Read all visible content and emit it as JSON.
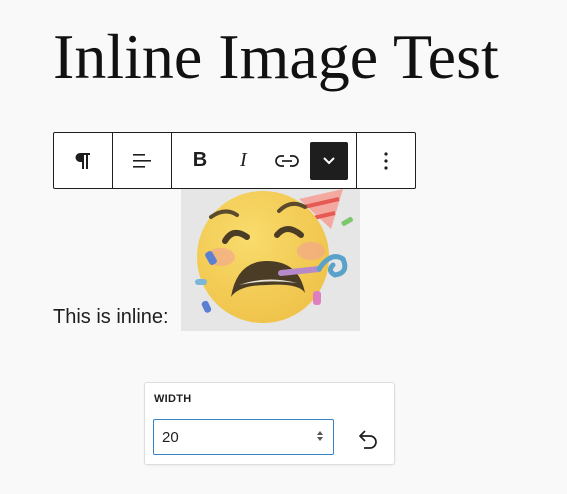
{
  "page": {
    "title": "Inline Image Test"
  },
  "paragraph": {
    "text": "This is inline:"
  },
  "toolbar": {
    "buttons": [
      {
        "name": "paragraph",
        "icon": "paragraph-icon"
      },
      {
        "name": "align",
        "icon": "align-left-icon"
      },
      {
        "name": "bold",
        "label": "B"
      },
      {
        "name": "italic",
        "label": "I"
      },
      {
        "name": "link",
        "icon": "link-icon"
      },
      {
        "name": "more-rich-text",
        "icon": "chevron-down-icon",
        "active": true
      },
      {
        "name": "options",
        "icon": "more-vertical-icon"
      }
    ]
  },
  "image": {
    "icon": "party-face-emoji"
  },
  "width_popover": {
    "label": "WIDTH",
    "value": "20",
    "reset_icon": "reset-arrow-icon"
  },
  "colors": {
    "accent": "#3582c4",
    "text": "#1e1e1e",
    "background": "#f9f9f9"
  }
}
